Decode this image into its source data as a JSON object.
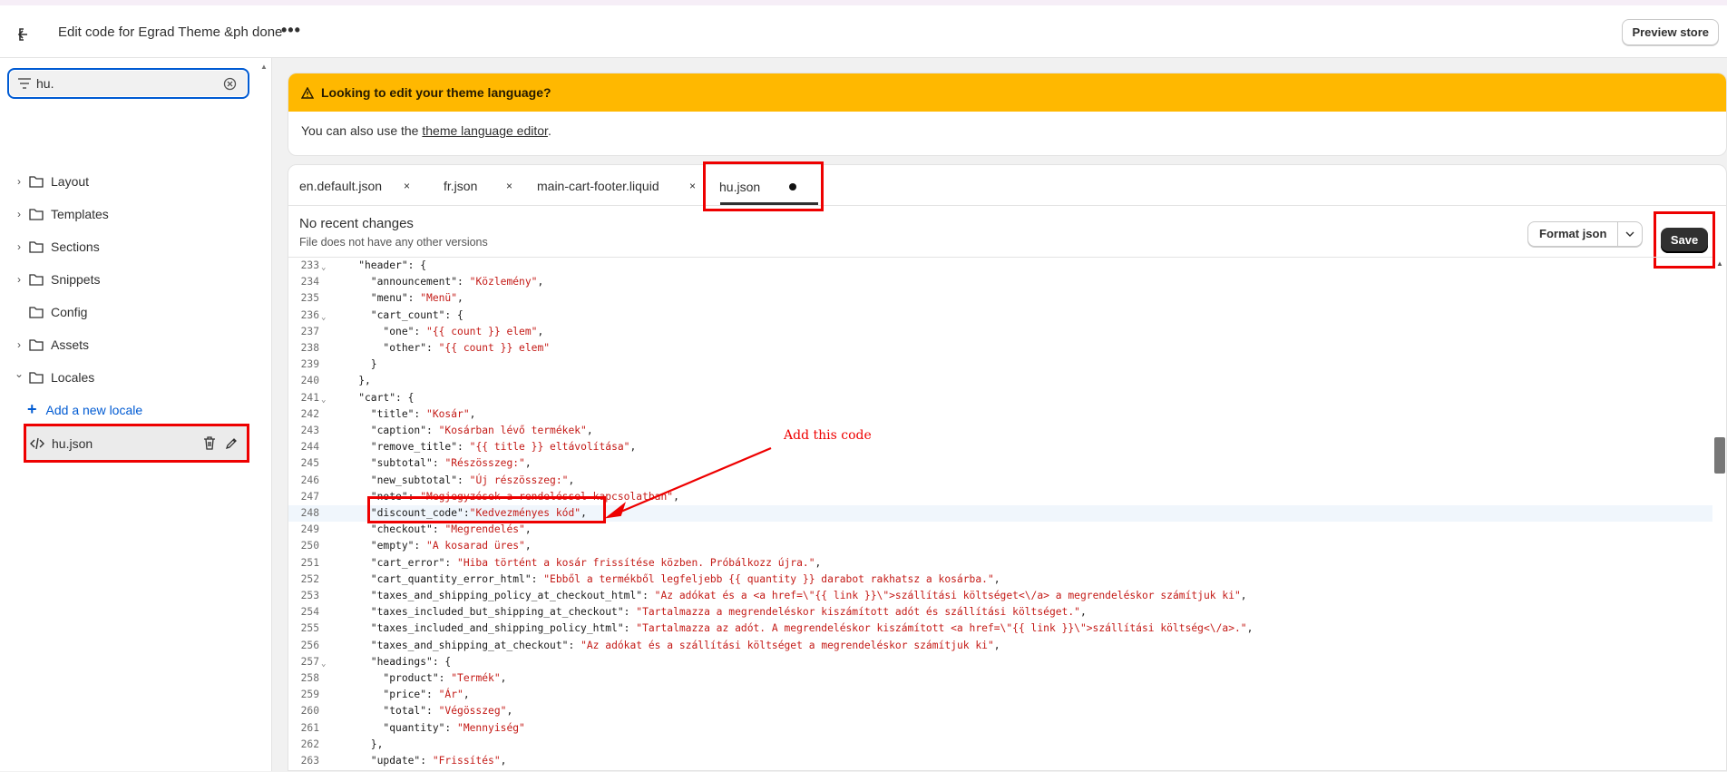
{
  "topbar": {
    "title": "Edit code for Egrad Theme &ph done",
    "more_icon": "more-horizontal-icon",
    "preview_label": "Preview store"
  },
  "sidebar": {
    "search_value": "hu.",
    "items": [
      {
        "label": "Layout",
        "expandable": true
      },
      {
        "label": "Templates",
        "expandable": true
      },
      {
        "label": "Sections",
        "expandable": true
      },
      {
        "label": "Snippets",
        "expandable": true
      },
      {
        "label": "Config",
        "expandable": false
      },
      {
        "label": "Assets",
        "expandable": true
      },
      {
        "label": "Locales",
        "expandable": true,
        "expanded": true
      }
    ],
    "add_locale_label": "Add a new locale",
    "file": {
      "name": "hu.json"
    }
  },
  "banner": {
    "title": "Looking to edit your theme language?",
    "body_prefix": "You can also use the ",
    "link": "theme language editor",
    "body_suffix": ".",
    "color": "#ffb800"
  },
  "tabs": [
    {
      "label": "en.default.json",
      "close": "×"
    },
    {
      "label": "fr.json",
      "close": "×"
    },
    {
      "label": "main-cart-footer.liquid",
      "close": "×"
    },
    {
      "label": "hu.json",
      "active": true,
      "unsaved": true
    }
  ],
  "info": {
    "heading": "No recent changes",
    "sub": "File does not have any other versions",
    "format_label": "Format json",
    "save_label": "Save"
  },
  "annotation": {
    "text": "Add this code"
  },
  "code": {
    "current_line": 248,
    "lines": [
      {
        "n": "233",
        "fold": true,
        "text": "    \"header\": {"
      },
      {
        "n": "234",
        "text": "      \"announcement\": ",
        "val": "\"Közlemény\"",
        "tail": ","
      },
      {
        "n": "235",
        "text": "      \"menu\": ",
        "val": "\"Menü\"",
        "tail": ","
      },
      {
        "n": "236",
        "fold": true,
        "text": "      \"cart_count\": {"
      },
      {
        "n": "237",
        "text": "        \"one\": ",
        "val": "\"{{ count }} elem\"",
        "tail": ","
      },
      {
        "n": "238",
        "text": "        \"other\": ",
        "val": "\"{{ count }} elem\"",
        "tail": ""
      },
      {
        "n": "239",
        "text": "      }"
      },
      {
        "n": "240",
        "text": "    },"
      },
      {
        "n": "241",
        "fold": true,
        "text": "    \"cart\": {"
      },
      {
        "n": "242",
        "text": "      \"title\": ",
        "val": "\"Kosár\"",
        "tail": ","
      },
      {
        "n": "243",
        "text": "      \"caption\": ",
        "val": "\"Kosárban lévő termékek\"",
        "tail": ","
      },
      {
        "n": "244",
        "text": "      \"remove_title\": ",
        "val": "\"{{ title }} eltávolítása\"",
        "tail": ","
      },
      {
        "n": "245",
        "text": "      \"subtotal\": ",
        "val": "\"Részösszeg:\"",
        "tail": ","
      },
      {
        "n": "246",
        "text": "      \"new_subtotal\": ",
        "val": "\"Új részösszeg:\"",
        "tail": ","
      },
      {
        "n": "247",
        "text": "      \"note\": ",
        "val": "\"Megjegyzések a rendeléssel kapcsolatban\"",
        "tail": ","
      },
      {
        "n": "248",
        "text": "      \"discount_code\":",
        "val": "\"Kedvezményes kód\"",
        "tail": ","
      },
      {
        "n": "249",
        "text": "      \"checkout\": ",
        "val": "\"Megrendelés\"",
        "tail": ","
      },
      {
        "n": "250",
        "text": "      \"empty\": ",
        "val": "\"A kosarad üres\"",
        "tail": ","
      },
      {
        "n": "251",
        "text": "      \"cart_error\": ",
        "val": "\"Hiba történt a kosár frissítése közben. Próbálkozz újra.\"",
        "tail": ","
      },
      {
        "n": "252",
        "text": "      \"cart_quantity_error_html\": ",
        "val": "\"Ebből a termékből legfeljebb {{ quantity }} darabot rakhatsz a kosárba.\"",
        "tail": ","
      },
      {
        "n": "253",
        "text": "      \"taxes_and_shipping_policy_at_checkout_html\": ",
        "val": "\"Az adókat és a <a href=\\\"{{ link }}\\\">szállítási költséget<\\/a> a megrendeléskor számítjuk ki\"",
        "tail": ","
      },
      {
        "n": "254",
        "text": "      \"taxes_included_but_shipping_at_checkout\": ",
        "val": "\"Tartalmazza a megrendeléskor kiszámított adót és szállítási költséget.\"",
        "tail": ","
      },
      {
        "n": "255",
        "text": "      \"taxes_included_and_shipping_policy_html\": ",
        "val": "\"Tartalmazza az adót. A megrendeléskor kiszámított <a href=\\\"{{ link }}\\\">szállítási költség<\\/a>.\"",
        "tail": ","
      },
      {
        "n": "256",
        "text": "      \"taxes_and_shipping_at_checkout\": ",
        "val": "\"Az adókat és a szállítási költséget a megrendeléskor számítjuk ki\"",
        "tail": ","
      },
      {
        "n": "257",
        "fold": true,
        "text": "      \"headings\": {"
      },
      {
        "n": "258",
        "text": "        \"product\": ",
        "val": "\"Termék\"",
        "tail": ","
      },
      {
        "n": "259",
        "text": "        \"price\": ",
        "val": "\"Ár\"",
        "tail": ","
      },
      {
        "n": "260",
        "text": "        \"total\": ",
        "val": "\"Végösszeg\"",
        "tail": ","
      },
      {
        "n": "261",
        "text": "        \"quantity\": ",
        "val": "\"Mennyiség\"",
        "tail": ""
      },
      {
        "n": "262",
        "text": "      },"
      },
      {
        "n": "263",
        "text": "      \"update\": ",
        "val": "\"Frissítés\"",
        "tail": ","
      }
    ]
  }
}
